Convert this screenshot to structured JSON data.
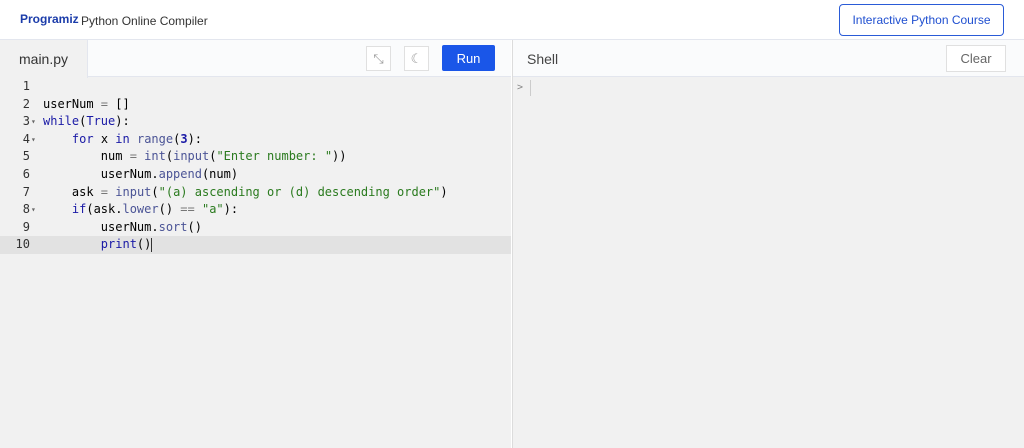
{
  "header": {
    "logo": "Programiz",
    "title": "Python Online Compiler",
    "course_button": "Interactive Python Course"
  },
  "editor": {
    "tab": "main.py",
    "run": "Run",
    "icons": [
      "compress-icon",
      "moon-icon"
    ],
    "lines": [
      {
        "n": "1",
        "fold": "",
        "tokens": []
      },
      {
        "n": "2",
        "fold": "",
        "tokens": [
          [
            "t",
            "userNum "
          ],
          [
            "o",
            "="
          ],
          [
            "t",
            " []"
          ]
        ]
      },
      {
        "n": "3",
        "fold": "▾",
        "tokens": [
          [
            "k",
            "while"
          ],
          [
            "t",
            "("
          ],
          [
            "k",
            "True"
          ],
          [
            "t",
            "):"
          ]
        ]
      },
      {
        "n": "4",
        "fold": "▾",
        "tokens": [
          [
            "t",
            "    "
          ],
          [
            "k",
            "for"
          ],
          [
            "t",
            " x "
          ],
          [
            "k",
            "in"
          ],
          [
            "t",
            " "
          ],
          [
            "f",
            "range"
          ],
          [
            "t",
            "("
          ],
          [
            "n",
            "3"
          ],
          [
            "t",
            "):"
          ]
        ]
      },
      {
        "n": "5",
        "fold": "",
        "tokens": [
          [
            "t",
            "        num "
          ],
          [
            "o",
            "="
          ],
          [
            "t",
            " "
          ],
          [
            "f",
            "int"
          ],
          [
            "t",
            "("
          ],
          [
            "f",
            "input"
          ],
          [
            "t",
            "("
          ],
          [
            "s",
            "\"Enter number: \""
          ],
          [
            "t",
            "))"
          ]
        ]
      },
      {
        "n": "6",
        "fold": "",
        "tokens": [
          [
            "t",
            "        userNum."
          ],
          [
            "f",
            "append"
          ],
          [
            "t",
            "(num)"
          ]
        ]
      },
      {
        "n": "7",
        "fold": "",
        "tokens": [
          [
            "t",
            "    ask "
          ],
          [
            "o",
            "="
          ],
          [
            "t",
            " "
          ],
          [
            "f",
            "input"
          ],
          [
            "t",
            "("
          ],
          [
            "s",
            "\"(a) ascending or (d) descending order\""
          ],
          [
            "t",
            ")"
          ]
        ]
      },
      {
        "n": "8",
        "fold": "▾",
        "tokens": [
          [
            "t",
            "    "
          ],
          [
            "k",
            "if"
          ],
          [
            "t",
            "(ask."
          ],
          [
            "f",
            "lower"
          ],
          [
            "t",
            "() "
          ],
          [
            "o",
            "=="
          ],
          [
            "t",
            " "
          ],
          [
            "s",
            "\"a\""
          ],
          [
            "t",
            "):"
          ]
        ]
      },
      {
        "n": "9",
        "fold": "",
        "tokens": [
          [
            "t",
            "        userNum."
          ],
          [
            "f",
            "sort"
          ],
          [
            "t",
            "()"
          ]
        ]
      },
      {
        "n": "10",
        "fold": "",
        "tokens": [
          [
            "t",
            "        "
          ],
          [
            "k",
            "print"
          ],
          [
            "t",
            "()"
          ]
        ]
      }
    ]
  },
  "shell": {
    "title": "Shell",
    "clear": "Clear",
    "prompt": ">"
  }
}
